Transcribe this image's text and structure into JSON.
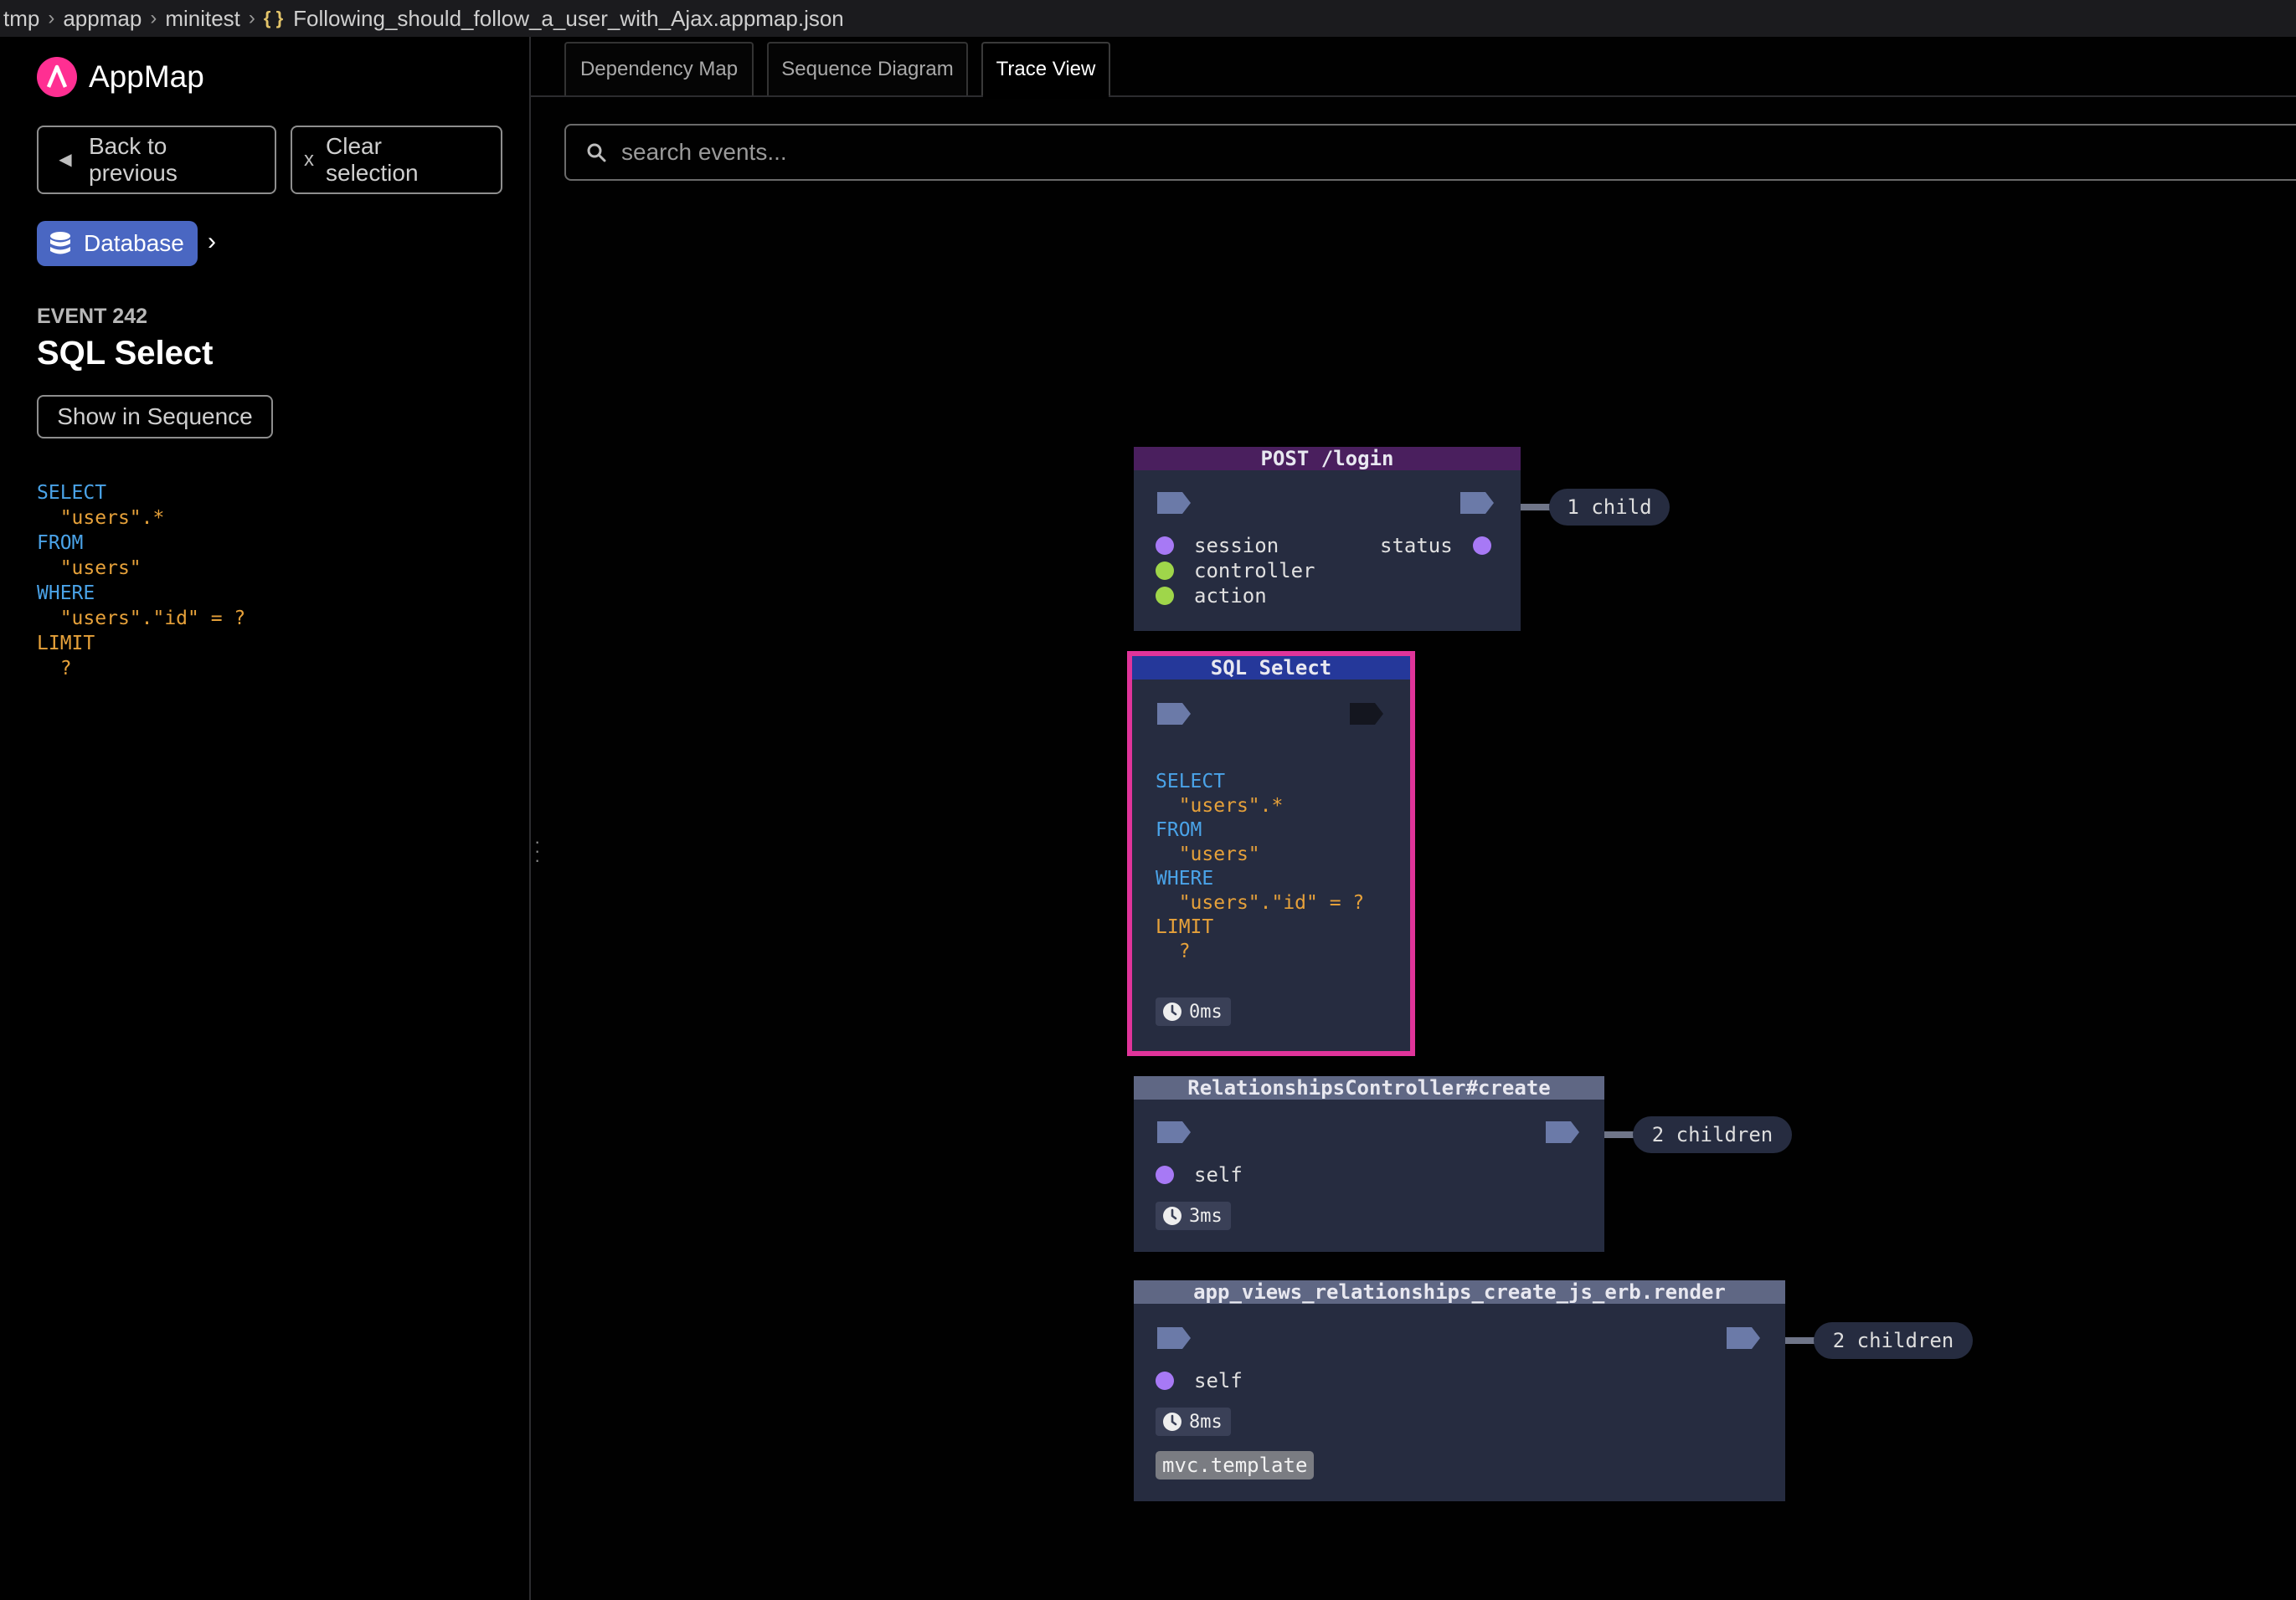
{
  "breadcrumb": {
    "items": [
      "tmp",
      "appmap",
      "minitest"
    ],
    "file_icon": "{ }",
    "file": "Following_should_follow_a_user_with_Ajax.appmap.json"
  },
  "sidebar": {
    "logo_text": "AppMap",
    "back_button": {
      "line1": "Back to",
      "line2": "previous"
    },
    "clear_button": {
      "icon": "x",
      "line1": "Clear",
      "line2": "selection"
    },
    "db_pill": "Database",
    "event_label": "EVENT 242",
    "event_title": "SQL Select",
    "show_in_sequence": "Show in Sequence",
    "sql": {
      "select": "SELECT",
      "cols": "\"users\".*",
      "from": "FROM",
      "table": "\"users\"",
      "where": "WHERE",
      "cond": "\"users\".\"id\" = ?",
      "limit": "LIMIT",
      "limit_val": "?"
    }
  },
  "tabs": {
    "dependency": "Dependency Map",
    "sequence": "Sequence Diagram",
    "trace": "Trace View",
    "active": "Trace View"
  },
  "search": {
    "placeholder": "search events..."
  },
  "trace": {
    "colors": {
      "http_header": "#4a1f5e",
      "sql_header": "#25389a",
      "func_header": "#5f6784",
      "node_bg": "#262c40",
      "selected_border": "#e0349a"
    },
    "post_login": {
      "title": "POST /login",
      "attrs": [
        "session",
        "controller",
        "action"
      ],
      "right_attr": "status",
      "children": "1 child"
    },
    "sql_select": {
      "title": "SQL Select",
      "select": "SELECT",
      "cols": "\"users\".*",
      "from": "FROM",
      "table": "\"users\"",
      "where": "WHERE",
      "cond": "\"users\".\"id\" = ?",
      "limit": "LIMIT",
      "limit_val": "?",
      "time": "0ms"
    },
    "relationships": {
      "title": "RelationshipsController#create",
      "attr": "self",
      "time": "3ms",
      "children": "2 children"
    },
    "render": {
      "title": "app_views_relationships_create_js_erb.render",
      "attr": "self",
      "time": "8ms",
      "tag": "mvc.template",
      "children": "2 children"
    }
  }
}
